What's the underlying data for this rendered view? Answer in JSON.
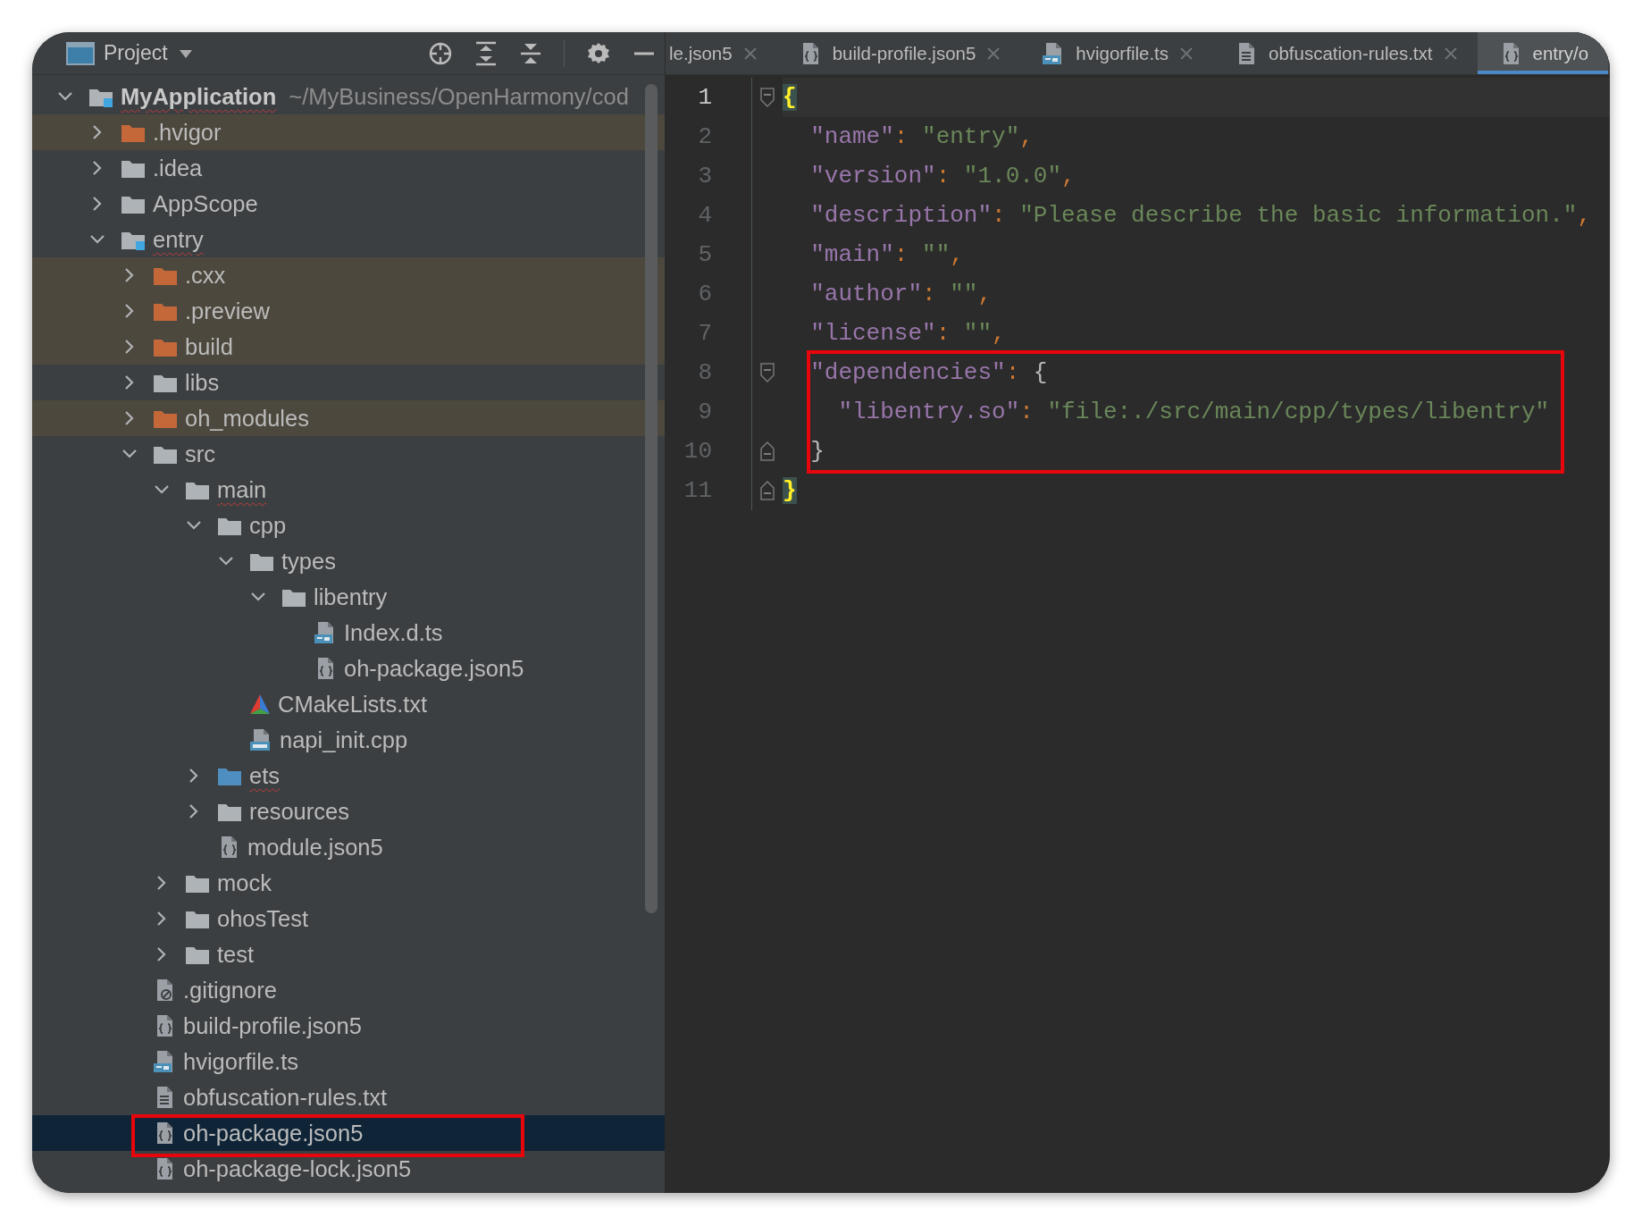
{
  "project": {
    "title": "Project",
    "tree": [
      {
        "label": "MyApplication",
        "path": "~/MyBusiness/OpenHarmony/cod",
        "kind": "module",
        "expanded": true,
        "selected": false,
        "excluded": false,
        "misspelled": true,
        "highlighted": false,
        "children": [
          {
            "label": ".hvigor",
            "kind": "folder",
            "expanded": false,
            "selected": false,
            "excluded": true,
            "misspelled": false,
            "highlighted": false
          },
          {
            "label": ".idea",
            "kind": "folder",
            "expanded": false,
            "selected": false,
            "excluded": false,
            "misspelled": false,
            "highlighted": false
          },
          {
            "label": "AppScope",
            "kind": "folder",
            "expanded": false,
            "selected": false,
            "excluded": false,
            "misspelled": false,
            "highlighted": false
          },
          {
            "label": "entry",
            "kind": "module",
            "expanded": true,
            "selected": false,
            "excluded": false,
            "misspelled": true,
            "highlighted": false,
            "children": [
              {
                "label": ".cxx",
                "kind": "folder",
                "expanded": false,
                "selected": false,
                "excluded": true,
                "misspelled": false,
                "highlighted": false
              },
              {
                "label": ".preview",
                "kind": "folder",
                "expanded": false,
                "selected": false,
                "excluded": true,
                "misspelled": false,
                "highlighted": false
              },
              {
                "label": "build",
                "kind": "folder",
                "expanded": false,
                "selected": false,
                "excluded": true,
                "misspelled": false,
                "highlighted": false
              },
              {
                "label": "libs",
                "kind": "folder",
                "expanded": false,
                "selected": false,
                "excluded": false,
                "misspelled": false,
                "highlighted": false
              },
              {
                "label": "oh_modules",
                "kind": "folder",
                "expanded": false,
                "selected": false,
                "excluded": true,
                "misspelled": false,
                "highlighted": false
              },
              {
                "label": "src",
                "kind": "folder",
                "expanded": true,
                "selected": false,
                "excluded": false,
                "misspelled": false,
                "highlighted": false,
                "children": [
                  {
                    "label": "main",
                    "kind": "folder",
                    "expanded": true,
                    "selected": false,
                    "excluded": false,
                    "misspelled": true,
                    "highlighted": false,
                    "children": [
                      {
                        "label": "cpp",
                        "kind": "folder",
                        "expanded": true,
                        "selected": false,
                        "excluded": false,
                        "misspelled": false,
                        "highlighted": false,
                        "children": [
                          {
                            "label": "types",
                            "kind": "folder",
                            "expanded": true,
                            "selected": false,
                            "excluded": false,
                            "misspelled": false,
                            "highlighted": false,
                            "children": [
                              {
                                "label": "libentry",
                                "kind": "folder",
                                "expanded": true,
                                "selected": false,
                                "excluded": false,
                                "misspelled": false,
                                "highlighted": false,
                                "children": [
                                  {
                                    "label": "Index.d.ts",
                                    "kind": "ts",
                                    "selected": false,
                                    "excluded": false,
                                    "misspelled": false,
                                    "highlighted": false
                                  },
                                  {
                                    "label": "oh-package.json5",
                                    "kind": "json",
                                    "selected": false,
                                    "excluded": false,
                                    "misspelled": false,
                                    "highlighted": false
                                  }
                                ]
                              }
                            ]
                          },
                          {
                            "label": "CMakeLists.txt",
                            "kind": "cmake",
                            "selected": false,
                            "excluded": false,
                            "misspelled": false,
                            "highlighted": false
                          },
                          {
                            "label": "napi_init.cpp",
                            "kind": "cpp",
                            "selected": false,
                            "excluded": false,
                            "misspelled": false,
                            "highlighted": false
                          }
                        ]
                      },
                      {
                        "label": "ets",
                        "kind": "source",
                        "expanded": false,
                        "selected": false,
                        "excluded": false,
                        "misspelled": true,
                        "highlighted": false
                      },
                      {
                        "label": "resources",
                        "kind": "folder",
                        "expanded": false,
                        "selected": false,
                        "excluded": false,
                        "misspelled": false,
                        "highlighted": false
                      },
                      {
                        "label": "module.json5",
                        "kind": "json",
                        "selected": false,
                        "excluded": false,
                        "misspelled": false,
                        "highlighted": false
                      }
                    ]
                  },
                  {
                    "label": "mock",
                    "kind": "folder",
                    "expanded": false,
                    "selected": false,
                    "excluded": false,
                    "misspelled": false,
                    "highlighted": false
                  },
                  {
                    "label": "ohosTest",
                    "kind": "folder",
                    "expanded": false,
                    "selected": false,
                    "excluded": false,
                    "misspelled": false,
                    "highlighted": false
                  },
                  {
                    "label": "test",
                    "kind": "folder",
                    "expanded": false,
                    "selected": false,
                    "excluded": false,
                    "misspelled": false,
                    "highlighted": false
                  }
                ]
              },
              {
                "label": ".gitignore",
                "kind": "git",
                "selected": false,
                "excluded": false,
                "misspelled": false,
                "highlighted": false
              },
              {
                "label": "build-profile.json5",
                "kind": "json",
                "selected": false,
                "excluded": false,
                "misspelled": false,
                "highlighted": false
              },
              {
                "label": "hvigorfile.ts",
                "kind": "ts",
                "selected": false,
                "excluded": false,
                "misspelled": false,
                "highlighted": false
              },
              {
                "label": "obfuscation-rules.txt",
                "kind": "txt",
                "selected": false,
                "excluded": false,
                "misspelled": false,
                "highlighted": false
              },
              {
                "label": "oh-package.json5",
                "kind": "json",
                "selected": true,
                "excluded": false,
                "misspelled": false,
                "highlighted": true
              },
              {
                "label": "oh-package-lock.json5",
                "kind": "json",
                "selected": false,
                "excluded": false,
                "misspelled": false,
                "highlighted": false
              }
            ]
          }
        ]
      }
    ]
  },
  "editor": {
    "tabs": [
      {
        "label": "le.json5",
        "kind": "none",
        "selected": false,
        "closable": true
      },
      {
        "label": "build-profile.json5",
        "kind": "json",
        "selected": false,
        "closable": true
      },
      {
        "label": "hvigorfile.ts",
        "kind": "ts",
        "selected": false,
        "closable": true
      },
      {
        "label": "obfuscation-rules.txt",
        "kind": "txt",
        "selected": false,
        "closable": true
      },
      {
        "label": "entry/o",
        "kind": "json",
        "selected": true,
        "closable": false
      }
    ],
    "lines": [
      {
        "number": "1",
        "current": true,
        "kind": "fold-start",
        "tokens": [
          {
            "kind": "brace",
            "text": "{"
          }
        ]
      },
      {
        "number": "2",
        "current": false,
        "kind": "plain",
        "tokens": [
          {
            "kind": "key",
            "text": "  \"name\""
          },
          {
            "kind": "punct",
            "text": ": "
          },
          {
            "kind": "str",
            "text": "\"entry\""
          },
          {
            "kind": "punct",
            "text": ","
          }
        ]
      },
      {
        "number": "3",
        "current": false,
        "kind": "plain",
        "tokens": [
          {
            "kind": "key",
            "text": "  \"version\""
          },
          {
            "kind": "punct",
            "text": ": "
          },
          {
            "kind": "str",
            "text": "\"1.0.0\""
          },
          {
            "kind": "punct",
            "text": ","
          }
        ]
      },
      {
        "number": "4",
        "current": false,
        "kind": "plain",
        "tokens": [
          {
            "kind": "key",
            "text": "  \"description\""
          },
          {
            "kind": "punct",
            "text": ": "
          },
          {
            "kind": "str",
            "text": "\"Please describe the basic information.\""
          },
          {
            "kind": "punct",
            "text": ","
          }
        ]
      },
      {
        "number": "5",
        "current": false,
        "kind": "plain",
        "tokens": [
          {
            "kind": "key",
            "text": "  \"main\""
          },
          {
            "kind": "punct",
            "text": ": "
          },
          {
            "kind": "str",
            "text": "\"\""
          },
          {
            "kind": "punct",
            "text": ","
          }
        ]
      },
      {
        "number": "6",
        "current": false,
        "kind": "plain",
        "tokens": [
          {
            "kind": "key",
            "text": "  \"author\""
          },
          {
            "kind": "punct",
            "text": ": "
          },
          {
            "kind": "str",
            "text": "\"\""
          },
          {
            "kind": "punct",
            "text": ","
          }
        ]
      },
      {
        "number": "7",
        "current": false,
        "kind": "plain",
        "tokens": [
          {
            "kind": "key",
            "text": "  \"license\""
          },
          {
            "kind": "punct",
            "text": ": "
          },
          {
            "kind": "str",
            "text": "\"\""
          },
          {
            "kind": "punct",
            "text": ","
          }
        ]
      },
      {
        "kind": "annotated-group",
        "children": [
          {
            "number": "8",
            "current": false,
            "kind": "fold-start",
            "tokens": [
              {
                "kind": "key",
                "text": "  \"dependencies\""
              },
              {
                "kind": "punct",
                "text": ": "
              },
              {
                "kind": "plain",
                "text": "{"
              }
            ]
          },
          {
            "number": "9",
            "current": false,
            "kind": "plain",
            "tokens": [
              {
                "kind": "key",
                "text": "    \"libentry.so\""
              },
              {
                "kind": "punct",
                "text": ": "
              },
              {
                "kind": "str",
                "text": "\"file:./src/main/cpp/types/libentry\""
              }
            ]
          },
          {
            "number": "10",
            "current": false,
            "kind": "fold-end",
            "tokens": [
              {
                "kind": "plain",
                "text": "  }"
              }
            ]
          }
        ]
      },
      {
        "number": "11",
        "current": false,
        "kind": "fold-end",
        "tokens": [
          {
            "kind": "brace",
            "text": "}"
          }
        ]
      }
    ]
  }
}
